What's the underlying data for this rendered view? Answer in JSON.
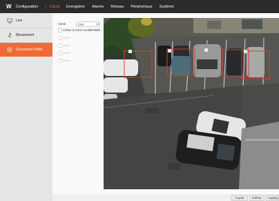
{
  "app": {
    "logo": "W"
  },
  "nav": {
    "items": [
      "Configuration",
      "|",
      "Canal",
      "Enregistrer",
      "Alarme",
      "Réseau",
      "Périphérique",
      "Système"
    ]
  },
  "sidebar": {
    "items": [
      {
        "label": "Live"
      },
      {
        "label": "Mouvement"
      },
      {
        "label": "Couverture Vidéo"
      }
    ]
  },
  "form": {
    "canal_label": "Canal",
    "canal_value": "CH2",
    "activate_label": "Activer la Zone Confidentielle",
    "zones": [
      "Area1",
      "Area2",
      "Area3",
      "Area4"
    ]
  },
  "video": {
    "box_labels": [
      "1",
      "2",
      "3",
      "4"
    ]
  },
  "buttons": {
    "copy": "Copier",
    "default": "Défaut",
    "apply": "Appliquer"
  },
  "colors": {
    "accent": "#f06a35",
    "topbar": "#2b2b2b",
    "zone_box": "#e23b2e"
  }
}
